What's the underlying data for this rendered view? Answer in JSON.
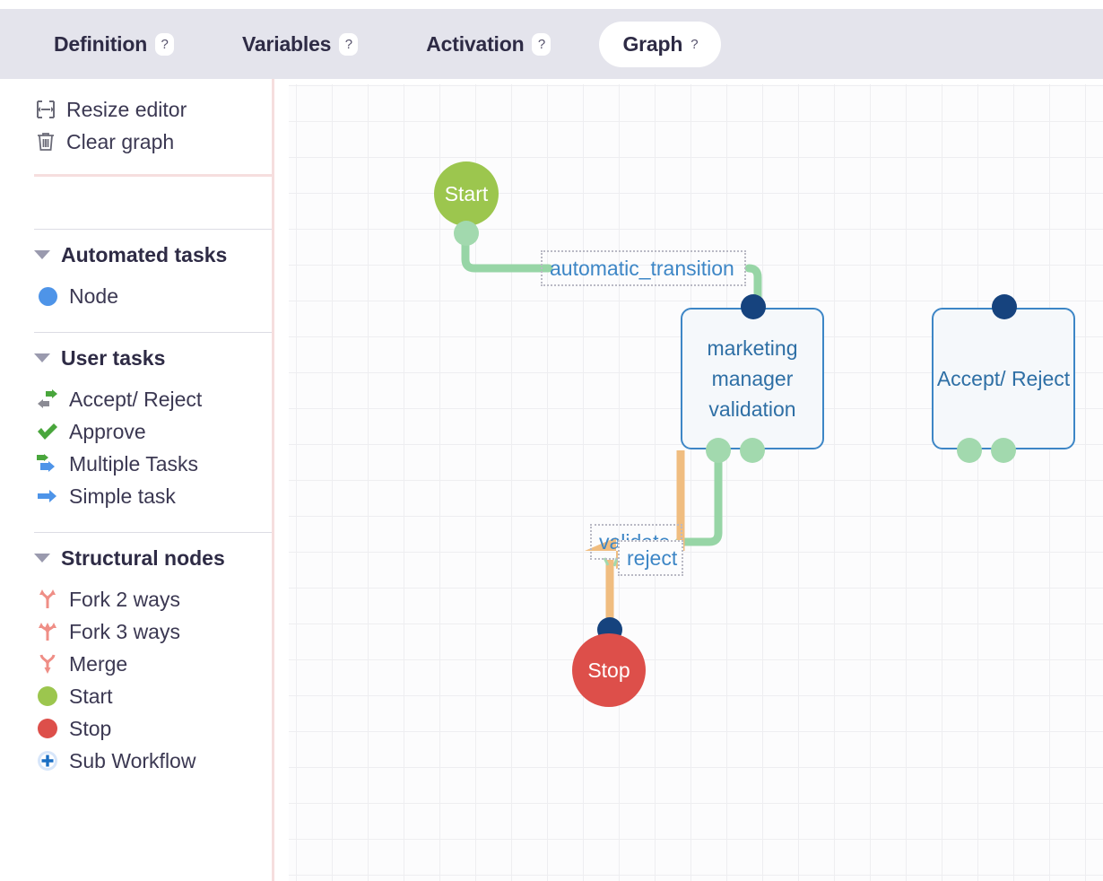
{
  "tabs": [
    {
      "label": "Definition",
      "help": "?",
      "active": false
    },
    {
      "label": "Variables",
      "help": "?",
      "active": false
    },
    {
      "label": "Activation",
      "help": "?",
      "active": false
    },
    {
      "label": "Graph",
      "help": "?",
      "active": true
    }
  ],
  "sidebar": {
    "actions": [
      {
        "label": "Resize editor",
        "icon": "resize-icon"
      },
      {
        "label": "Clear graph",
        "icon": "trash-icon"
      }
    ],
    "groups": [
      {
        "title": "Automated tasks",
        "items": [
          {
            "label": "Node",
            "icon": "blue-circle-icon"
          }
        ]
      },
      {
        "title": "User tasks",
        "items": [
          {
            "label": "Accept/ Reject",
            "icon": "accept-reject-arrows-icon"
          },
          {
            "label": "Approve",
            "icon": "green-check-icon"
          },
          {
            "label": "Multiple Tasks",
            "icon": "multiple-arrows-icon"
          },
          {
            "label": "Simple task",
            "icon": "blue-arrow-icon"
          }
        ]
      },
      {
        "title": "Structural nodes",
        "items": [
          {
            "label": "Fork 2 ways",
            "icon": "fork-2-icon"
          },
          {
            "label": "Fork 3 ways",
            "icon": "fork-3-icon"
          },
          {
            "label": "Merge",
            "icon": "merge-icon"
          },
          {
            "label": "Start",
            "icon": "green-circle-icon"
          },
          {
            "label": "Stop",
            "icon": "red-circle-icon"
          },
          {
            "label": "Sub Workflow",
            "icon": "sub-workflow-plus-icon"
          }
        ]
      }
    ]
  },
  "graph": {
    "nodes": [
      {
        "id": "start",
        "label": "Start",
        "type": "start"
      },
      {
        "id": "marketing",
        "label": "marketing manager validation",
        "type": "task"
      },
      {
        "id": "accept_reject",
        "label": "Accept/ Reject",
        "type": "task"
      },
      {
        "id": "stop",
        "label": "Stop",
        "type": "stop"
      }
    ],
    "edge_labels": [
      {
        "id": "automatic_transition",
        "label": "automatic_transition"
      },
      {
        "id": "validate",
        "label": "validate"
      },
      {
        "id": "reject",
        "label": "reject"
      }
    ]
  },
  "colors": {
    "start_green": "#9cc košice",
    "accent_blue": "#3d86c6",
    "port_navy": "#16437e",
    "port_green": "#a2d9ae",
    "edge_green": "#97d5a6",
    "edge_orange": "#f0bd80",
    "stop_red": "#dd4f4a",
    "start_circle": "#9cc64e",
    "tabbar_bg": "#e4e4ec"
  }
}
